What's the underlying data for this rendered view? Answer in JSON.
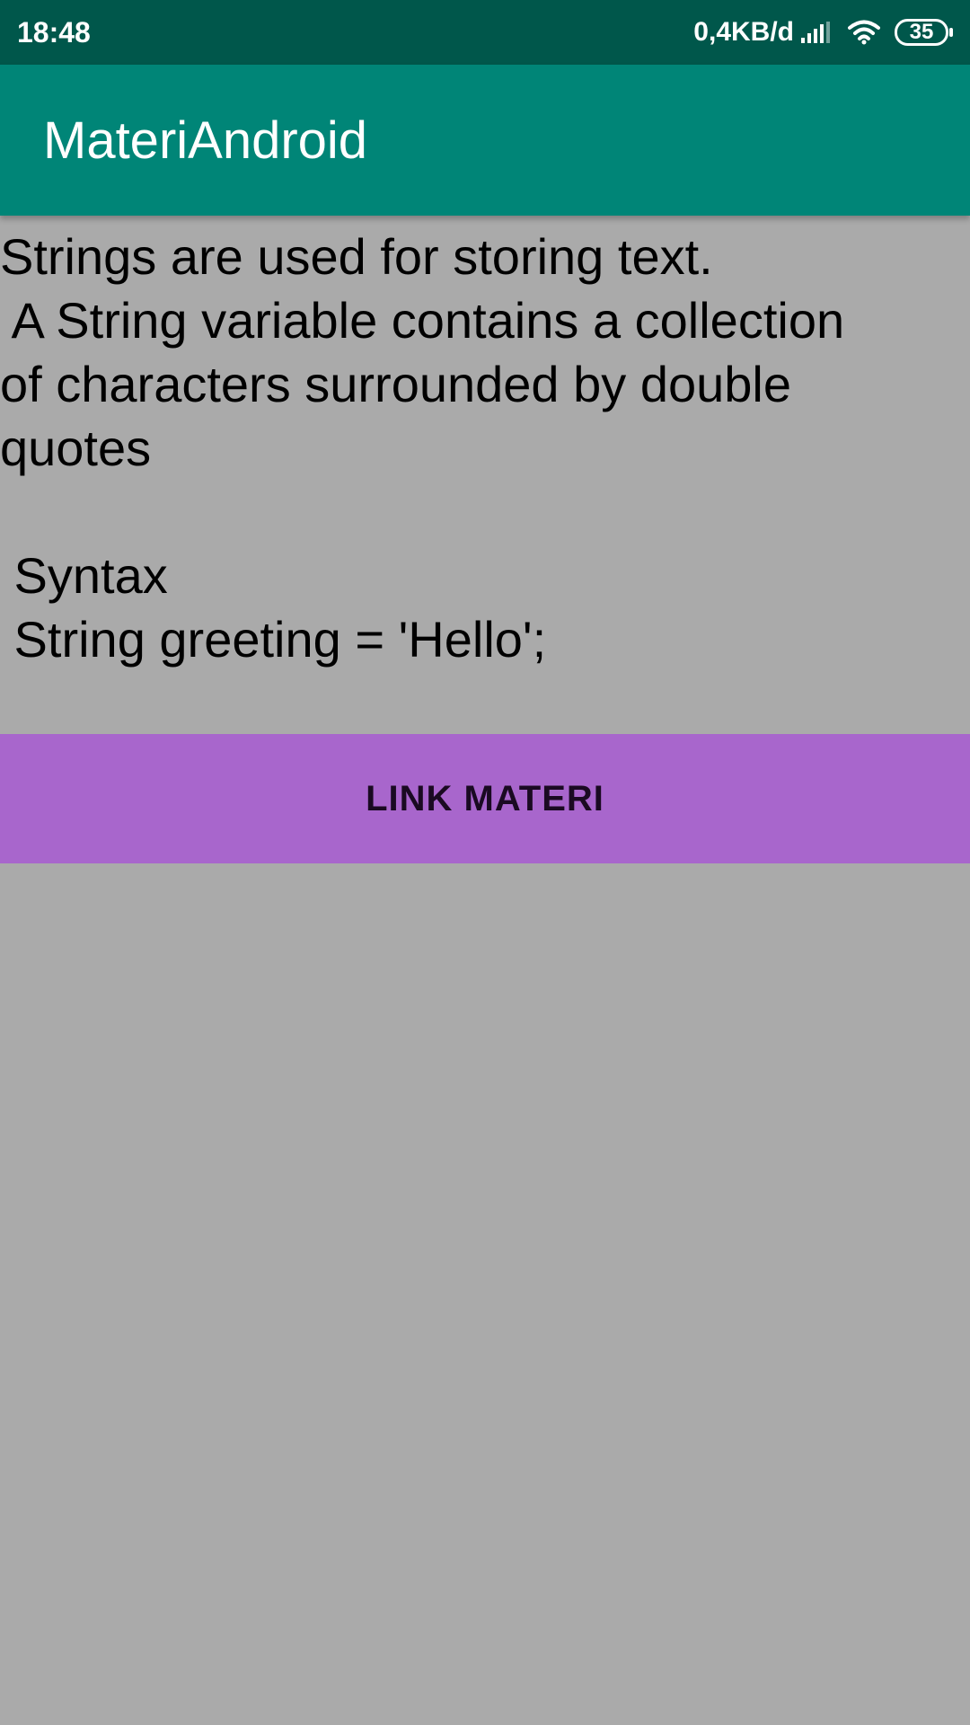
{
  "status_bar": {
    "time": "18:48",
    "net_speed": "0,4KB/d",
    "battery_level": "35",
    "icons": [
      "signal-icon",
      "wifi-icon",
      "battery-icon"
    ]
  },
  "app_bar": {
    "title": "MateriAndroid"
  },
  "content": {
    "text": "Strings are used for storing text.\n A String variable contains a collection\nof characters surrounded by double\nquotes\n\n Syntax\n String greeting = 'Hello';"
  },
  "button": {
    "label": "LINK MATERI"
  },
  "colors": {
    "status_bar": "#00574b",
    "app_bar": "#008577",
    "background": "#aaaaaa",
    "button": "#a866cc"
  }
}
